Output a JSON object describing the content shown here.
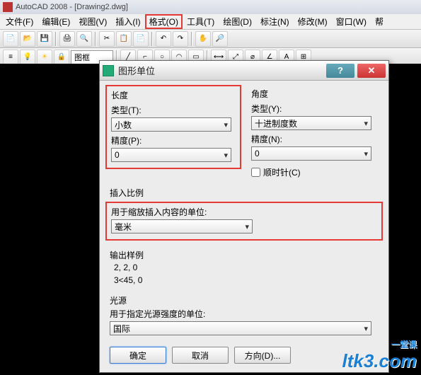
{
  "app": {
    "title": "AutoCAD 2008 - [Drawing2.dwg]"
  },
  "menu": {
    "file": "文件(F)",
    "edit": "编辑(E)",
    "view": "视图(V)",
    "insert": "插入(I)",
    "format": "格式(O)",
    "tools": "工具(T)",
    "draw": "绘图(D)",
    "dim": "标注(N)",
    "modify": "修改(M)",
    "window": "窗口(W)",
    "help": "帮"
  },
  "toolbar": {
    "layer_combo": "图框"
  },
  "dialog": {
    "title": "图形单位",
    "length": {
      "group": "长度",
      "type_label": "类型(T):",
      "type_value": "小数",
      "precision_label": "精度(P):",
      "precision_value": "0"
    },
    "angle": {
      "group": "角度",
      "type_label": "类型(Y):",
      "type_value": "十进制度数",
      "precision_label": "精度(N):",
      "precision_value": "0",
      "clockwise": "顺时针(C)"
    },
    "insert": {
      "group": "插入比例",
      "label": "用于缩放插入内容的单位:",
      "value": "毫米"
    },
    "sample": {
      "group": "输出样例",
      "line1": "2, 2, 0",
      "line2": "3<45, 0"
    },
    "light": {
      "group": "光源",
      "label": "用于指定光源强度的单位:",
      "value": "国际"
    },
    "buttons": {
      "ok": "确定",
      "cancel": "取消",
      "direction": "方向(D)..."
    }
  },
  "watermark": {
    "text": "ltk3.com",
    "sub": "一堂课"
  }
}
